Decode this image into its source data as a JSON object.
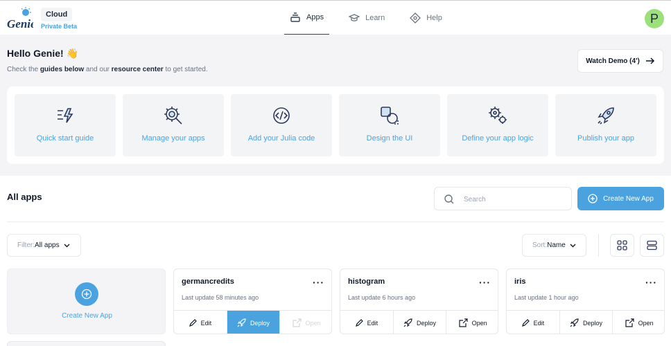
{
  "brand": {
    "name": "Cloud",
    "subtitle": "Private Beta",
    "logo": "genie-logo"
  },
  "nav": [
    {
      "label": "Apps",
      "icon": "stack-icon",
      "active": true
    },
    {
      "label": "Learn",
      "icon": "graduation-cap-icon",
      "active": false
    },
    {
      "label": "Help",
      "icon": "diamond-icon",
      "active": false
    }
  ],
  "user": {
    "initial": "P",
    "avatar_color": "#9be07a"
  },
  "hero": {
    "greeting": "Hello Genie! 👋",
    "sub_prefix": "Check the ",
    "sub_link1": "guides below",
    "sub_mid": " and our ",
    "sub_link2": "resource center",
    "sub_suffix": " to get started.",
    "watch_demo": "Watch Demo (4')"
  },
  "guides": [
    {
      "label": "Quick start guide",
      "icon": "lightning-list-icon"
    },
    {
      "label": "Manage your apps",
      "icon": "gear-search-icon"
    },
    {
      "label": "Add your Julia code",
      "icon": "code-icon"
    },
    {
      "label": "Design the UI",
      "icon": "shapes-icon"
    },
    {
      "label": "Define your app logic",
      "icon": "gears-icon"
    },
    {
      "label": "Publish your app",
      "icon": "rocket-icon"
    }
  ],
  "apps_section": {
    "title": "All apps",
    "search_placeholder": "Search",
    "create_label": "Create New App",
    "filter_prefix": "Filter: ",
    "filter_value": "All apps",
    "sort_prefix": "Sort: ",
    "sort_value": "Name"
  },
  "new_card": {
    "label": "Create New App"
  },
  "apps": [
    {
      "name": "germancredits",
      "updated": "Last update 58 minutes ago",
      "actions": [
        "Edit",
        "Deploy",
        "Open"
      ],
      "deploy_active": true,
      "open_disabled": true
    },
    {
      "name": "histogram",
      "updated": "Last update 6 hours ago",
      "actions": [
        "Edit",
        "Deploy",
        "Open"
      ],
      "deploy_active": false,
      "open_disabled": false
    },
    {
      "name": "iris",
      "updated": "Last update 1 hour ago",
      "actions": [
        "Edit",
        "Deploy",
        "Open"
      ],
      "deploy_active": false,
      "open_disabled": false
    }
  ],
  "colors": {
    "accent": "#4aa3df",
    "background": "#f4f4f6",
    "text": "#111827"
  }
}
